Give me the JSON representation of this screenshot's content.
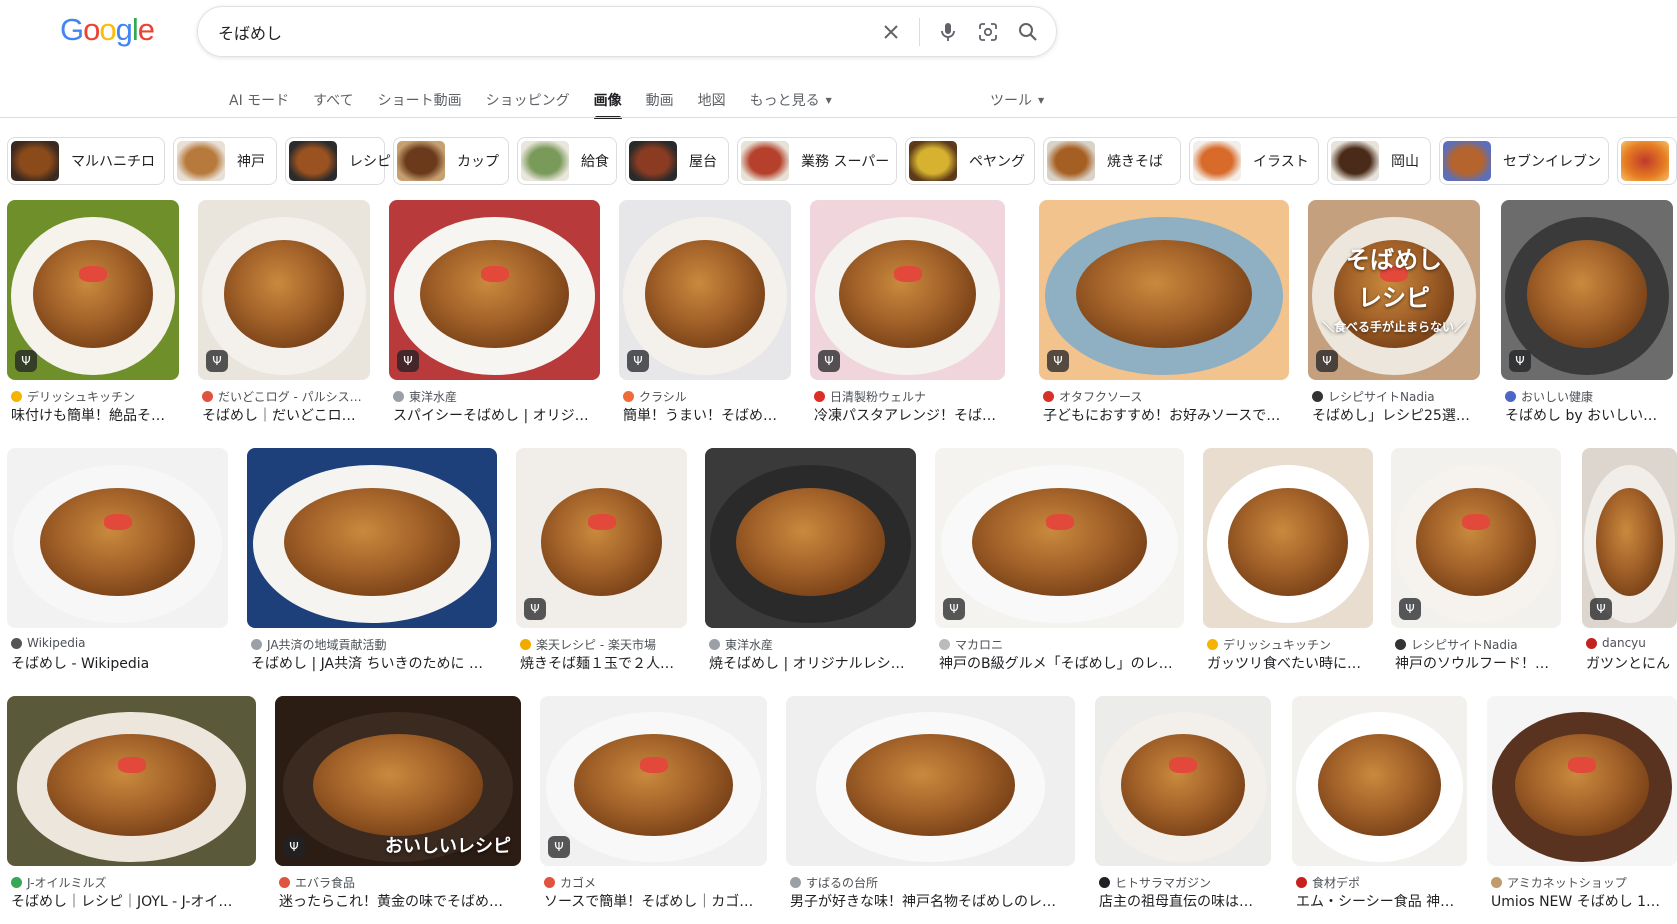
{
  "logo": {
    "text": "Google"
  },
  "search": {
    "value": "そばめし"
  },
  "tabs": [
    {
      "label": "AI モード"
    },
    {
      "label": "すべて"
    },
    {
      "label": "ショート動画"
    },
    {
      "label": "ショッピング"
    },
    {
      "label": "画像",
      "active": true
    },
    {
      "label": "動画"
    },
    {
      "label": "地図"
    },
    {
      "label": "もっと見る",
      "caret": true
    }
  ],
  "tools_label": "ツール",
  "chips": [
    "マルハニチロ",
    "神戸",
    "レシピ",
    "カップ",
    "給食",
    "屋台",
    "業務 スーパー",
    "ペヤング",
    "焼きそば",
    "イラスト",
    "岡山",
    "セブンイレブン"
  ],
  "results": {
    "row1": [
      {
        "source": "デリッシュキッチン",
        "title": "味付けも簡単！絶品そ…",
        "fav": "#f5b400"
      },
      {
        "source": "だいどこログ - パルシス…",
        "title": "そばめし｜だいどこロ…",
        "fav": "#e0533f"
      },
      {
        "source": "東洋水産",
        "title": "スパイシーそばめし | オリジ…",
        "fav": "#9aa0a6"
      },
      {
        "source": "クラシル",
        "title": "簡単！うまい！そばめ…",
        "fav": "#f06a3a"
      },
      {
        "source": "日清製粉ウェルナ",
        "title": "冷凍パスタアレンジ！そばめ…",
        "fav": "#d93025"
      },
      {
        "source": "オタフクソース",
        "title": "子どもにおすすめ！お好みソースで…",
        "fav": "#d93025"
      },
      {
        "source": "レシピサイトNadia",
        "title": "そばめし」レシピ25選…",
        "fav": "#333"
      },
      {
        "source": "おいしい健康",
        "title": "そばめし by おいしい…",
        "fav": "#4a67c7"
      }
    ],
    "row1_overlay": {
      "line1": "そばめし",
      "line2": "レシピ",
      "line3": "＼食べる手が止まらない／"
    },
    "row2": [
      {
        "source": "Wikipedia",
        "title": "そばめし - Wikipedia",
        "fav": "#555"
      },
      {
        "source": "JA共済の地域貢献活動",
        "title": "そばめし | JA共済 ちいきのために …",
        "fav": "#9aa0a6"
      },
      {
        "source": "楽天レシピ - 楽天市場",
        "title": "焼きそば麺１玉で２人…",
        "fav": "#f2a900"
      },
      {
        "source": "東洋水産",
        "title": "焼そばめし | オリジナルレシ…",
        "fav": "#9aa0a6"
      },
      {
        "source": "マカロニ",
        "title": "神戸のB級グルメ「そばめし」のレ…",
        "fav": "#bbb"
      },
      {
        "source": "デリッシュキッチン",
        "title": "ガッツリ食べたい時に…",
        "fav": "#f5b400"
      },
      {
        "source": "レシピサイトNadia",
        "title": "神戸のソウルフード！…",
        "fav": "#333"
      },
      {
        "source": "dancyu",
        "title": "ガツンとにん",
        "fav": "#c5221f"
      }
    ],
    "row3": [
      {
        "source": "J-オイルミルズ",
        "title": "そばめし｜レシピ｜JOYL - J-オイ…",
        "fav": "#34a853"
      },
      {
        "source": "エバラ食品",
        "title": "迷ったらこれ！黄金の味でそばめ…",
        "fav": "#e0533f"
      },
      {
        "source": "カゴメ",
        "title": "ソースで簡単！そばめし｜カゴ…",
        "fav": "#e0533f"
      },
      {
        "source": "すばるの台所",
        "title": "男子が好きな味！神戸名物そばめしのレ…",
        "fav": "#9aa0a6"
      },
      {
        "source": "ヒトサラマガジン",
        "title": "店主の祖母直伝の味は…",
        "fav": "#202124"
      },
      {
        "source": "食材デポ",
        "title": "エム・シーシー食品 神…",
        "fav": "#c5221f"
      },
      {
        "source": "アミカネットショップ",
        "title": "Umios NEW そばめし 1…",
        "fav": "#c29b6c"
      }
    ],
    "row3_overlay": "おいしいレシピ"
  },
  "icons": {
    "clear": "close-icon",
    "mic": "microphone-icon",
    "lens": "camera-lens-icon",
    "search": "search-icon",
    "recipe_badge": "fork-knife-icon"
  },
  "colors": {
    "google_blue": "#4285f4",
    "google_red": "#ea4335",
    "google_yellow": "#fbbc05",
    "google_green": "#34a853"
  }
}
